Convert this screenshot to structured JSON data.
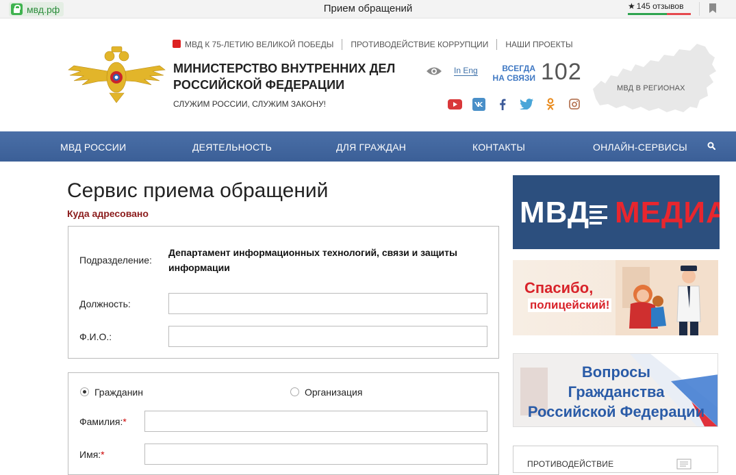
{
  "browser": {
    "url": "мвд.рф",
    "page_title": "Прием обращений",
    "reviews": "145 отзывов"
  },
  "header": {
    "top_links": [
      "МВД К 75-ЛЕТИЮ ВЕЛИКОЙ ПОБЕДЫ",
      "ПРОТИВОДЕЙСТВИЕ КОРРУПЦИИ",
      "НАШИ ПРОЕКТЫ"
    ],
    "title_line1": "МИНИСТЕРСТВО ВНУТРЕННИХ ДЕЛ",
    "title_line2": "РОССИЙСКОЙ ФЕДЕРАЦИИ",
    "motto": "СЛУЖИМ РОССИИ, СЛУЖИМ ЗАКОНУ!",
    "lang_link": "In Eng",
    "always_line1": "ВСЕГДА",
    "always_line2": "НА СВЯЗИ",
    "hotline": "102",
    "regions_label": "МВД В РЕГИОНАХ",
    "social_icons": [
      "youtube-icon",
      "vk-icon",
      "facebook-icon",
      "twitter-icon",
      "odnoklassniki-icon",
      "instagram-icon"
    ]
  },
  "nav": {
    "items": [
      "МВД РОССИИ",
      "ДЕЯТЕЛЬНОСТЬ",
      "ДЛЯ ГРАЖДАН",
      "КОНТАКТЫ",
      "ОНЛАЙН-СЕРВИСЫ"
    ]
  },
  "main": {
    "heading": "Сервис приема обращений",
    "addressed_label": "Куда адресовано",
    "division_label": "Подразделение:",
    "division_value": "Департамент информационных технологий, связи и защиты информации",
    "position_label": "Должность:",
    "position_value": "",
    "fio_label": "Ф.И.О.:",
    "fio_value": "",
    "applicant_types": [
      "Гражданин",
      "Организация"
    ],
    "selected_type": "Гражданин",
    "lastname_label": "Фамилия:",
    "lastname_value": "",
    "firstname_label": "Имя:",
    "firstname_value": "",
    "required_mark": "*"
  },
  "sidebar": {
    "banner1_left": "МВД",
    "banner1_right": "МЕДИА",
    "banner2_line1": "Спасибо,",
    "banner2_line2": "полицейский!",
    "banner3_line1": "Вопросы",
    "banner3_line2": "Гражданства",
    "banner3_line3": "Российской Федерации",
    "banner4_text": "ПРОТИВОДЕЙСТВИЕ"
  },
  "colors": {
    "nav_blue": "#3f649c",
    "accent_red": "#8b1c1c",
    "link_blue": "#3c6fa8",
    "media_red": "#e8262e"
  }
}
